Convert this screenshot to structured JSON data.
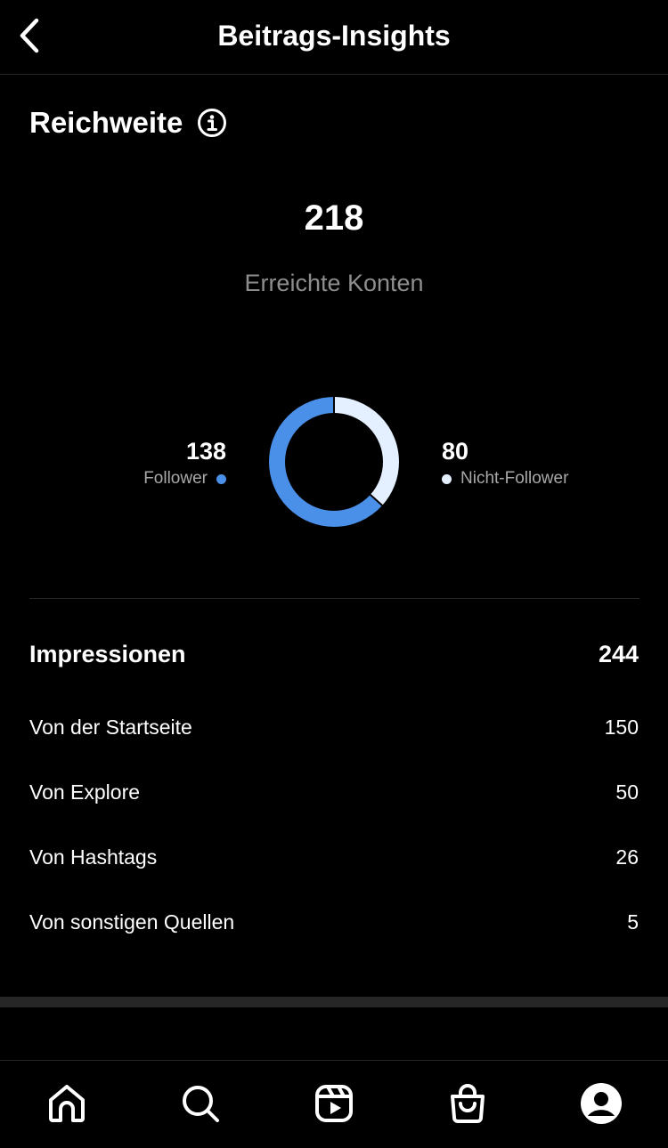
{
  "header": {
    "title": "Beitrags-Insights"
  },
  "reach": {
    "title": "Reichweite",
    "accounts_reached": "218",
    "accounts_reached_label": "Erreichte Konten",
    "followers": {
      "value": "138",
      "label": "Follower",
      "color": "#4a90e8"
    },
    "non_followers": {
      "value": "80",
      "label": "Nicht-Follower",
      "color": "#e4efff"
    }
  },
  "chart_data": {
    "type": "pie",
    "categories": [
      "Follower",
      "Nicht-Follower"
    ],
    "values": [
      138,
      80
    ],
    "colors": [
      "#4a90e8",
      "#e4efff"
    ],
    "style": "donut"
  },
  "impressions": {
    "label": "Impressionen",
    "value": "244",
    "sources": [
      {
        "label": "Von der Startseite",
        "value": "150"
      },
      {
        "label": "Von Explore",
        "value": "50"
      },
      {
        "label": "Von Hashtags",
        "value": "26"
      },
      {
        "label": "Von sonstigen Quellen",
        "value": "5"
      }
    ]
  },
  "tabbar": {
    "tabs": [
      {
        "name": "home-icon"
      },
      {
        "name": "search-icon"
      },
      {
        "name": "reels-icon"
      },
      {
        "name": "shop-icon"
      },
      {
        "name": "profile-icon"
      }
    ]
  }
}
